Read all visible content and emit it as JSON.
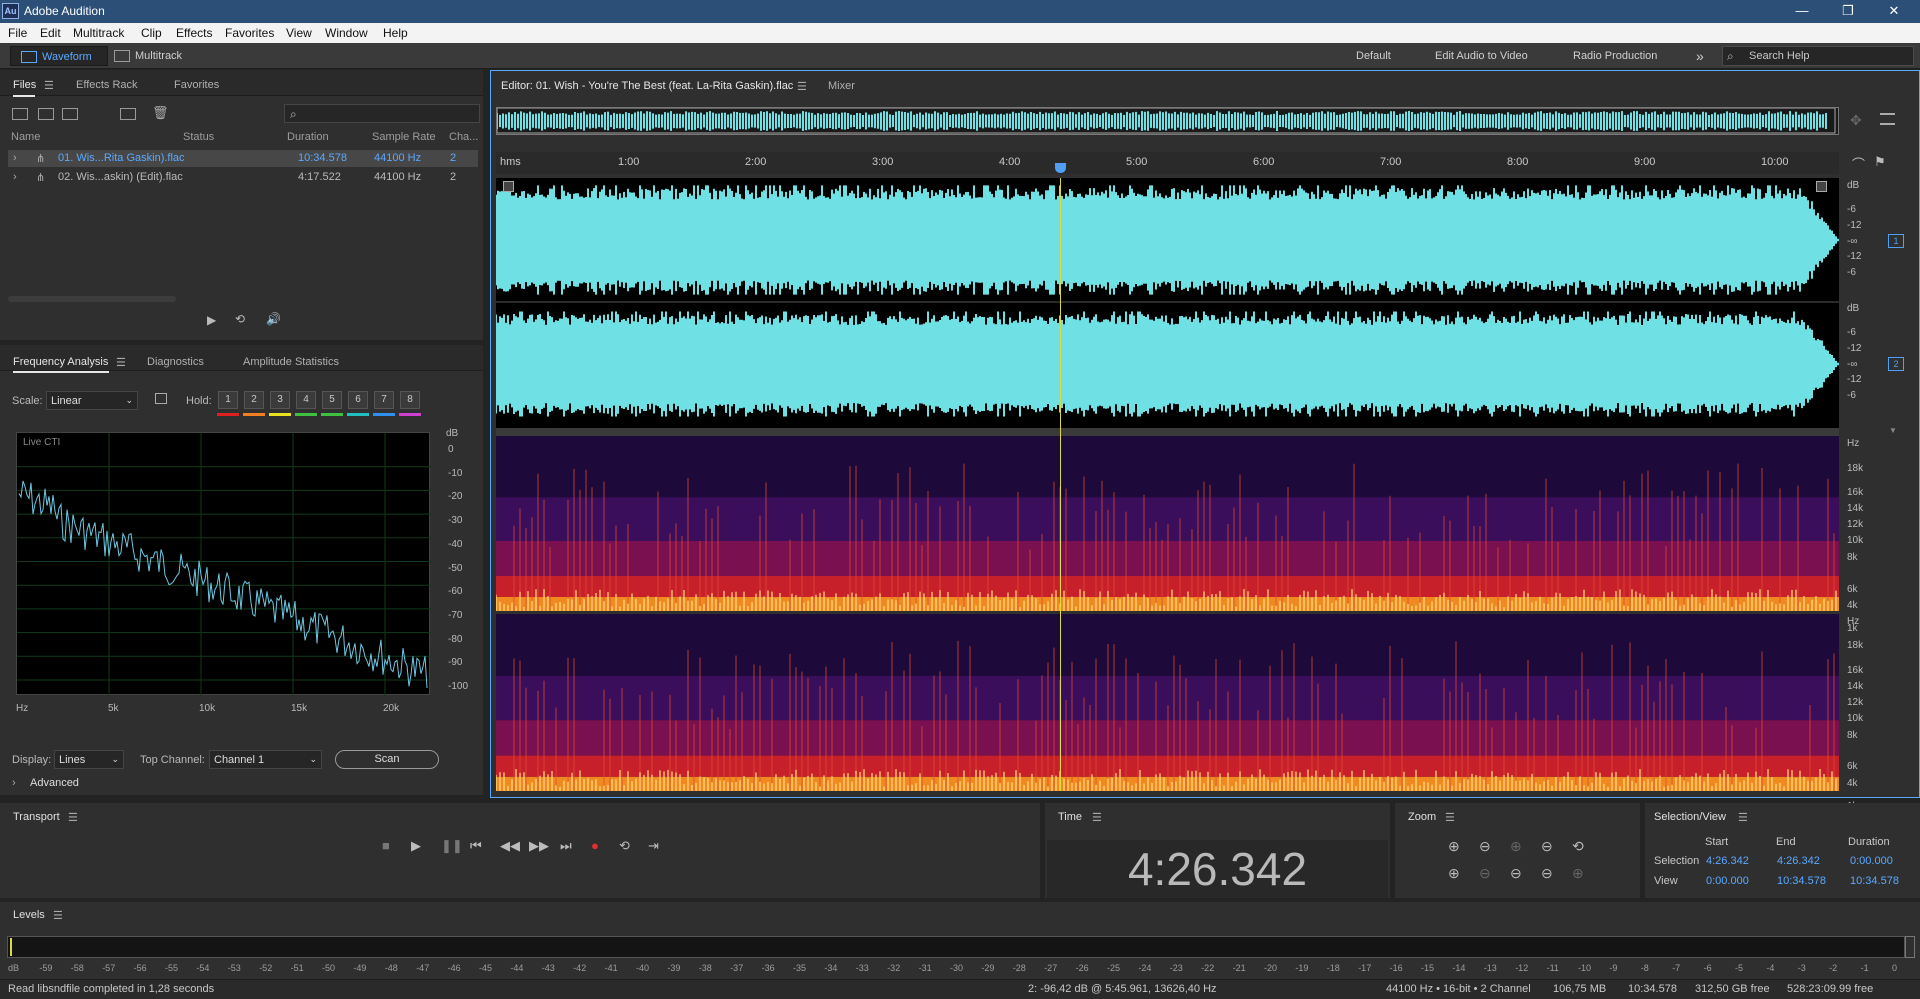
{
  "app": {
    "title": "Adobe Audition",
    "logo": "Au"
  },
  "menu": [
    "File",
    "Edit",
    "Multitrack",
    "Clip",
    "Effects",
    "Favorites",
    "View",
    "Window",
    "Help"
  ],
  "toolbar": {
    "waveform": "Waveform",
    "multitrack": "Multitrack",
    "workspaces": [
      "Default",
      "Edit Audio to Video",
      "Radio Production"
    ],
    "more": "»",
    "search_placeholder": "Search Help"
  },
  "files_panel": {
    "tabs": [
      "Files",
      "Effects Rack",
      "Favorites"
    ],
    "columns": [
      "Name",
      "Status",
      "Duration",
      "Sample Rate",
      "Cha..."
    ],
    "search_icon": "⌕",
    "rows": [
      {
        "name": "01. Wis...Rita Gaskin).flac",
        "duration": "10:34.578",
        "rate": "44100 Hz",
        "channels": "2",
        "selected": true
      },
      {
        "name": "02. Wis...askin) (Edit).flac",
        "duration": "4:17.522",
        "rate": "44100 Hz",
        "channels": "2",
        "selected": false
      }
    ]
  },
  "freq": {
    "tabs": [
      "Frequency Analysis",
      "Diagnostics",
      "Amplitude Statistics"
    ],
    "scale_label": "Scale:",
    "scale_value": "Linear",
    "hold_label": "Hold:",
    "holds": [
      "1",
      "2",
      "3",
      "4",
      "5",
      "6",
      "7",
      "8"
    ],
    "hold_colors": [
      "#e02020",
      "#f08020",
      "#e8e020",
      "#40c040",
      "#40c040",
      "#20c0c0",
      "#3090f0",
      "#d040d0"
    ],
    "live": "Live CTI",
    "db_unit": "dB",
    "db_ticks": [
      "0",
      "-10",
      "-20",
      "-30",
      "-40",
      "-50",
      "-60",
      "-70",
      "-80",
      "-90",
      "-100"
    ],
    "hz_ticks": [
      "Hz",
      "5k",
      "10k",
      "15k",
      "20k"
    ],
    "display_label": "Display:",
    "display_value": "Lines",
    "top_channel_label": "Top Channel:",
    "top_channel_value": "Channel 1",
    "scan": "Scan",
    "advanced": "Advanced"
  },
  "editor": {
    "tab": "Editor: 01. Wish - You're The Best (feat. La-Rita Gaskin).flac",
    "mixer": "Mixer",
    "ruler": [
      "hms",
      "1:00",
      "2:00",
      "3:00",
      "4:00",
      "5:00",
      "6:00",
      "7:00",
      "8:00",
      "9:00",
      "10:00"
    ],
    "db_unit": "dB",
    "db_ticks": [
      "-6",
      "-12",
      "-∞",
      "-12",
      "-6"
    ],
    "channels": [
      "1",
      "2"
    ],
    "hz_unit": "Hz",
    "hz_ticks": [
      "18k",
      "16k",
      "14k",
      "12k",
      "10k",
      "8k",
      "6k",
      "4k",
      "1k"
    ],
    "wave_color": "#6fe0e3",
    "cti_color": "#d8dc3c"
  },
  "transport": {
    "label": "Transport"
  },
  "time": {
    "label": "Time",
    "value": "4:26.342"
  },
  "zoom": {
    "label": "Zoom"
  },
  "selview": {
    "label": "Selection/View",
    "cols": [
      "Start",
      "End",
      "Duration"
    ],
    "selection_label": "Selection",
    "view_label": "View",
    "selection": [
      "4:26.342",
      "4:26.342",
      "0:00.000"
    ],
    "view": [
      "0:00.000",
      "10:34.578",
      "10:34.578"
    ]
  },
  "levels": {
    "label": "Levels",
    "ticks": [
      "dB",
      "-59",
      "-58",
      "-57",
      "-56",
      "-55",
      "-54",
      "-53",
      "-52",
      "-51",
      "-50",
      "-49",
      "-48",
      "-47",
      "-46",
      "-45",
      "-44",
      "-43",
      "-42",
      "-41",
      "-40",
      "-39",
      "-38",
      "-37",
      "-36",
      "-35",
      "-34",
      "-33",
      "-32",
      "-31",
      "-30",
      "-29",
      "-28",
      "-27",
      "-26",
      "-25",
      "-24",
      "-23",
      "-22",
      "-21",
      "-20",
      "-19",
      "-18",
      "-17",
      "-16",
      "-15",
      "-14",
      "-13",
      "-12",
      "-11",
      "-10",
      "-9",
      "-8",
      "-7",
      "-6",
      "-5",
      "-4",
      "-3",
      "-2",
      "-1",
      "0"
    ]
  },
  "status": {
    "message": "Read libsndfile completed in 1,28 seconds",
    "cursor": "2: -96,42 dB @ 5:45.961, 13626,40 Hz",
    "format": "44100 Hz • 16-bit • 2 Channel",
    "size": "106,75 MB",
    "duration": "10:34.578",
    "free": "312,50 GB free",
    "free_time": "528:23:09.99 free"
  }
}
